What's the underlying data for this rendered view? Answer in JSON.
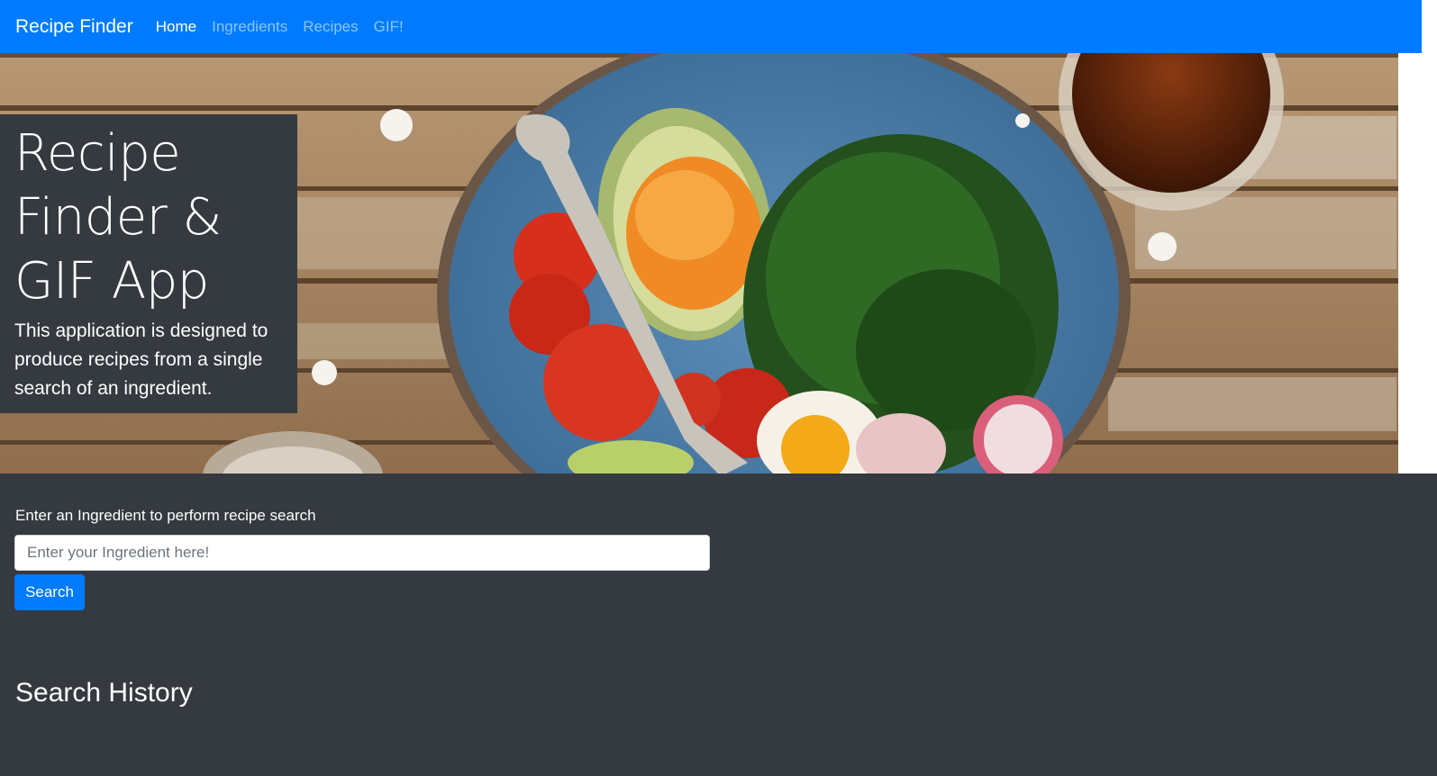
{
  "navbar": {
    "brand": "Recipe Finder",
    "links": [
      {
        "label": "Home",
        "active": true
      },
      {
        "label": "Ingredients",
        "active": false
      },
      {
        "label": "Recipes",
        "active": false
      },
      {
        "label": "GIF!",
        "active": false
      }
    ]
  },
  "hero": {
    "title_lines": [
      "Recipe",
      "Finder &",
      "GIF App"
    ],
    "description": "This application is designed to produce recipes from a single search of an ingredient."
  },
  "search": {
    "label": "Enter an Ingredient to perform recipe search",
    "placeholder": "Enter your Ingredient here!",
    "value": "",
    "button_label": "Search"
  },
  "history": {
    "title": "Search History"
  },
  "colors": {
    "primary": "#007bff",
    "background": "#343a40",
    "text": "#ffffff"
  }
}
